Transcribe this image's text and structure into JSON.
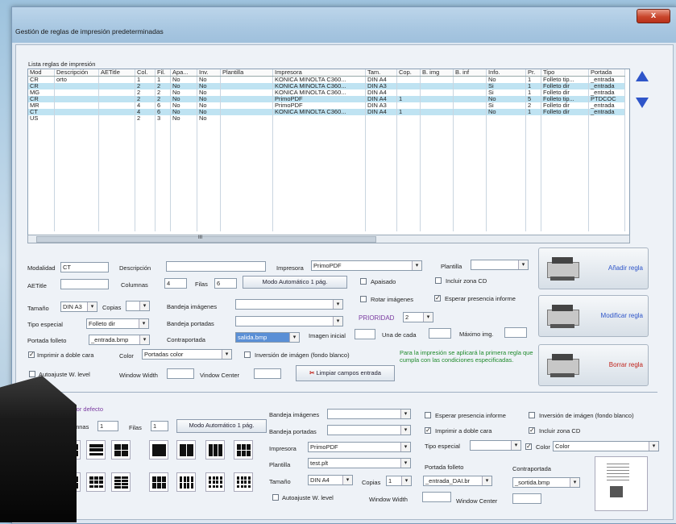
{
  "window": {
    "title": "Gestión de reglas de impresión predeterminadas",
    "close_label": "x"
  },
  "list": {
    "label": "Lista reglas de impresión",
    "columns": [
      "Mod",
      "Descripción",
      "AETitle",
      "Col.",
      "Fil.",
      "Apa...",
      "Inv.",
      "Plantilla",
      "Impresora",
      "Tam.",
      "Cop.",
      "B. img",
      "B. inf",
      "Info.",
      "Pr.",
      "Tipo",
      "Portada"
    ],
    "rows": [
      [
        "CR",
        "orto",
        "",
        "1",
        "1",
        "No",
        "No",
        "",
        "KONICA MINOLTA C360...",
        "DIN A4",
        "",
        "",
        "",
        "No",
        "1",
        "Folleto tip...",
        "_entrada"
      ],
      [
        "CR",
        "",
        "",
        "2",
        "2",
        "No",
        "No",
        "",
        "KONICA MINOLTA C360...",
        "DIN A3",
        "",
        "",
        "",
        "Si",
        "1",
        "Folleto dir",
        "_entrada"
      ],
      [
        "MG",
        "",
        "",
        "2",
        "2",
        "No",
        "No",
        "",
        "KONICA MINOLTA C360...",
        "DIN A4",
        "",
        "",
        "",
        "Si",
        "1",
        "Folleto dir",
        "_entrada"
      ],
      [
        "CR",
        "",
        "",
        "2",
        "2",
        "No",
        "No",
        "",
        "PrimoPDF",
        "DIN A4",
        "1",
        "",
        "",
        "No",
        "5",
        "Folleto tip...",
        "PTDCOC"
      ],
      [
        "MR",
        "",
        "",
        "4",
        "6",
        "No",
        "No",
        "",
        "PrimoPDF",
        "DIN A3",
        "",
        "",
        "",
        "Si",
        "2",
        "Folleto dir",
        "_entrada"
      ],
      [
        "CT",
        "",
        "",
        "4",
        "6",
        "No",
        "No",
        "",
        "KONICA MINOLTA C360...",
        "DIN A4",
        "1",
        "",
        "",
        "No",
        "1",
        "Folleto dir",
        "_entrada"
      ],
      [
        "US",
        "",
        "",
        "2",
        "3",
        "No",
        "No",
        "",
        "",
        "",
        "",
        "",
        "",
        "",
        "",
        "",
        ""
      ]
    ],
    "scroll_label": "III"
  },
  "form": {
    "modalidad_label": "Modalidad",
    "modalidad_value": "CT",
    "descripcion_label": "Descripción",
    "descripcion_value": "",
    "impresora_label": "Impresora",
    "impresora_value": "PrimoPDF",
    "plantilla_label": "Plantilla",
    "plantilla_value": "",
    "aetitle_label": "AETitle",
    "aetitle_value": "",
    "columnas_label": "Columnas",
    "columnas_value": "4",
    "filas_label": "Filas",
    "filas_value": "6",
    "modo_button": "Modo Automático 1 pág.",
    "apaisado_label": "Apaisado",
    "incluir_cd_label": "Incluir zona CD",
    "tamano_label": "Tamaño",
    "tamano_value": "DIN A3",
    "copias_label": "Copias",
    "copias_value": "",
    "bandeja_img_label": "Bandeja imágenes",
    "bandeja_img_value": "",
    "rotar_label": "Rotar imágenes",
    "esperar_label": "Esperar presencia informe",
    "tipo_label": "Tipo especial",
    "tipo_value": "Folleto dir",
    "bandeja_port_label": "Bandeja portadas",
    "bandeja_port_value": "",
    "prioridad_label": "PRIORIDAD",
    "prioridad_value": "2",
    "portada_label": "Portada folleto",
    "portada_value": "_entrada.bmp",
    "contraportada_label": "Contraportada",
    "contraportada_value": "salida.bmp",
    "imagen_inicial_label": "Imagen inicial",
    "una_cada_label": "Una de cada",
    "maximo_label": "Máximo img.",
    "doble_cara_label": "Imprimir a doble cara",
    "color_label": "Color",
    "color_value": "Portadas color",
    "inversion_label": "Inversión de imágen (fondo blanco)",
    "info_text": "Para la impresión se aplicará la primera regla que cumpla con las condiciones especificadas.",
    "autoajuste_label": "Autoajuste W. level",
    "window_width_label": "Window Width",
    "window_center_label": "Vindow Center",
    "limpiar_button": "Limpiar campos entrada"
  },
  "actions": {
    "add": "Añadir regla",
    "modify": "Modificar regla",
    "delete": "Borrar regla"
  },
  "defaults": {
    "title": "resión por defecto",
    "columnas_label": "olumnas",
    "columnas_value": "1",
    "filas_label": "Filas",
    "filas_value": "1",
    "modo_button": "Modo Automático 1 pág.",
    "bandeja_img_label": "Bandeja imágenes",
    "bandeja_port_label": "Bandeja portadas",
    "impresora_label": "Impresora",
    "impresora_value": "PrimoPDF",
    "plantilla_label": "Plantilla",
    "plantilla_value": "test.plt",
    "tamano_label": "Tamaño",
    "tamano_value": "DIN A4",
    "copias_label": "Copias",
    "copias_value": "1",
    "autoajuste_label": "Autoajuste W. level",
    "window_width_label": "Window Width",
    "window_center_label": "Window Center",
    "esperar_label": "Esperar presencia informe",
    "inversion_label": "Inversión de imágen (fondo blanco)",
    "doble_cara_label": "Imprimir a doble cara",
    "incluir_cd_label": "Incluir zona CD",
    "tipo_label": "Tipo especial",
    "tipo_value": "",
    "color_label": "Color",
    "color_value": "Color",
    "portada_label": "Portada folleto",
    "portada_value": "_entrada_DAI.br",
    "contraportada_label": "Contraportada",
    "contraportada_value": "_sortida.bmp"
  },
  "colors": {
    "accent_blue": "#2e55c9",
    "delete_red": "#c0221a",
    "info_green": "#1f8a2c",
    "prioridad_purple": "#7a3aa0"
  }
}
